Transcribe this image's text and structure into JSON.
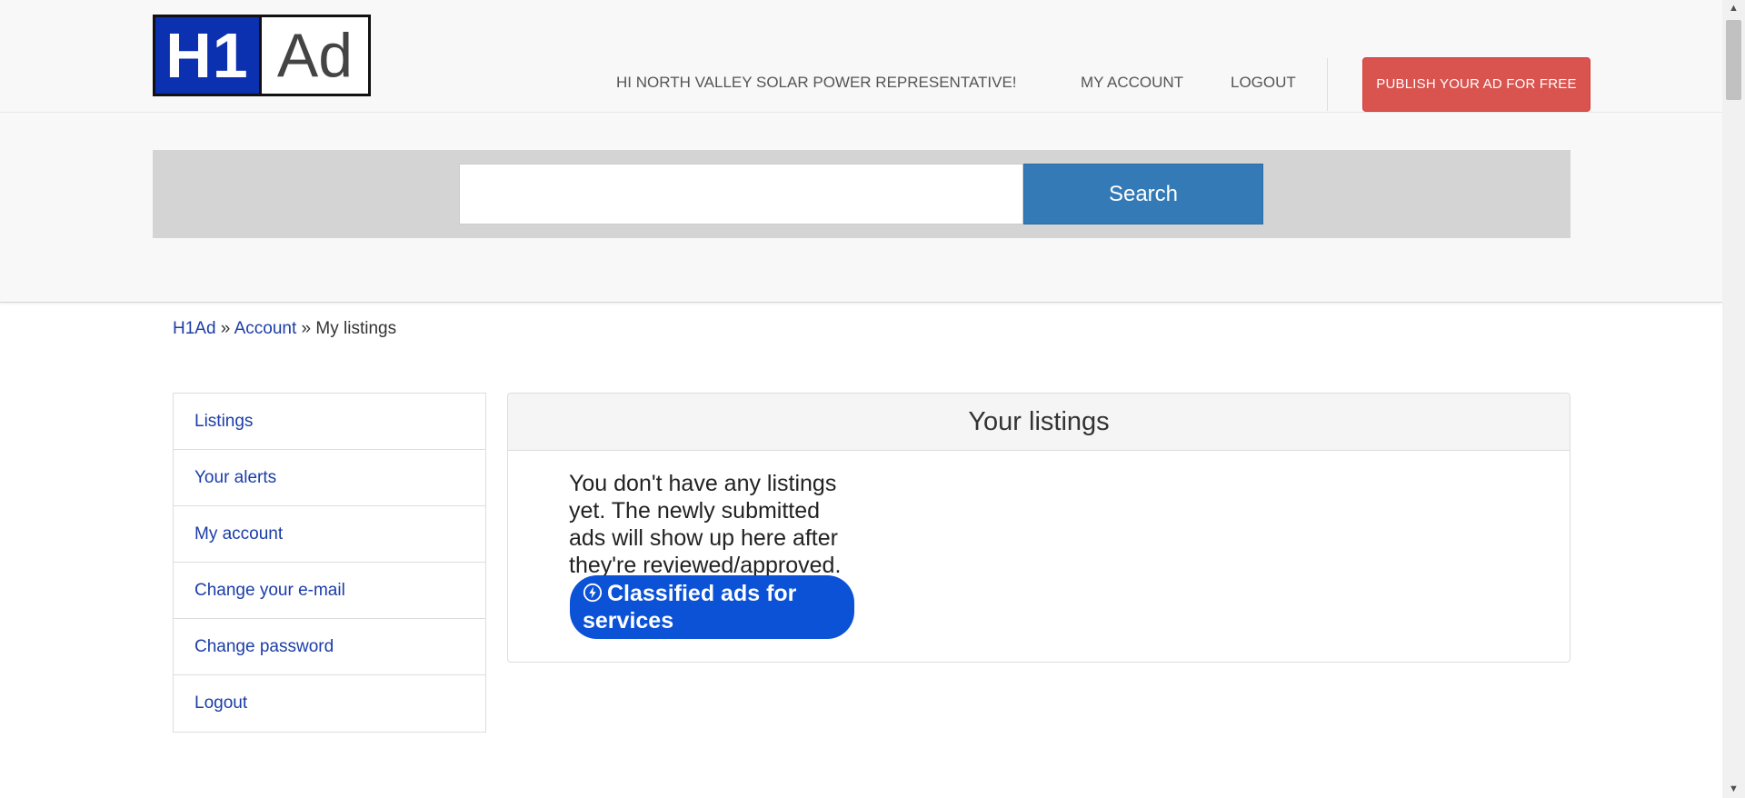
{
  "header": {
    "logo": {
      "left": "H1",
      "right": "Ad"
    },
    "nav": {
      "greeting": "HI NORTH VALLEY SOLAR POWER REPRESENTATIVE!",
      "my_account": "MY ACCOUNT",
      "logout": "LOGOUT"
    },
    "publish_button": "PUBLISH YOUR AD FOR FREE",
    "search": {
      "placeholder": "",
      "value": "",
      "button_label": "Search"
    },
    "colors": {
      "publish": "#d9534f",
      "search_button": "#337ab7",
      "logo_blue": "#0b30b0"
    }
  },
  "breadcrumb": {
    "home": "H1Ad",
    "sep1": " » ",
    "account": "Account",
    "sep2": " » ",
    "current": "My listings"
  },
  "sidebar": {
    "items": [
      {
        "label": "Listings"
      },
      {
        "label": "Your alerts"
      },
      {
        "label": "My account"
      },
      {
        "label": "Change your e-mail"
      },
      {
        "label": "Change password"
      },
      {
        "label": "Logout"
      }
    ]
  },
  "main": {
    "heading": "Your listings",
    "empty_message": "You don't have any listings yet. The newly submitted ads will show up here after they're reviewed/approved.",
    "category_badge": {
      "icon": "bolt-circle-icon",
      "label": "Classified ads for services",
      "color": "#0b52d6"
    }
  }
}
